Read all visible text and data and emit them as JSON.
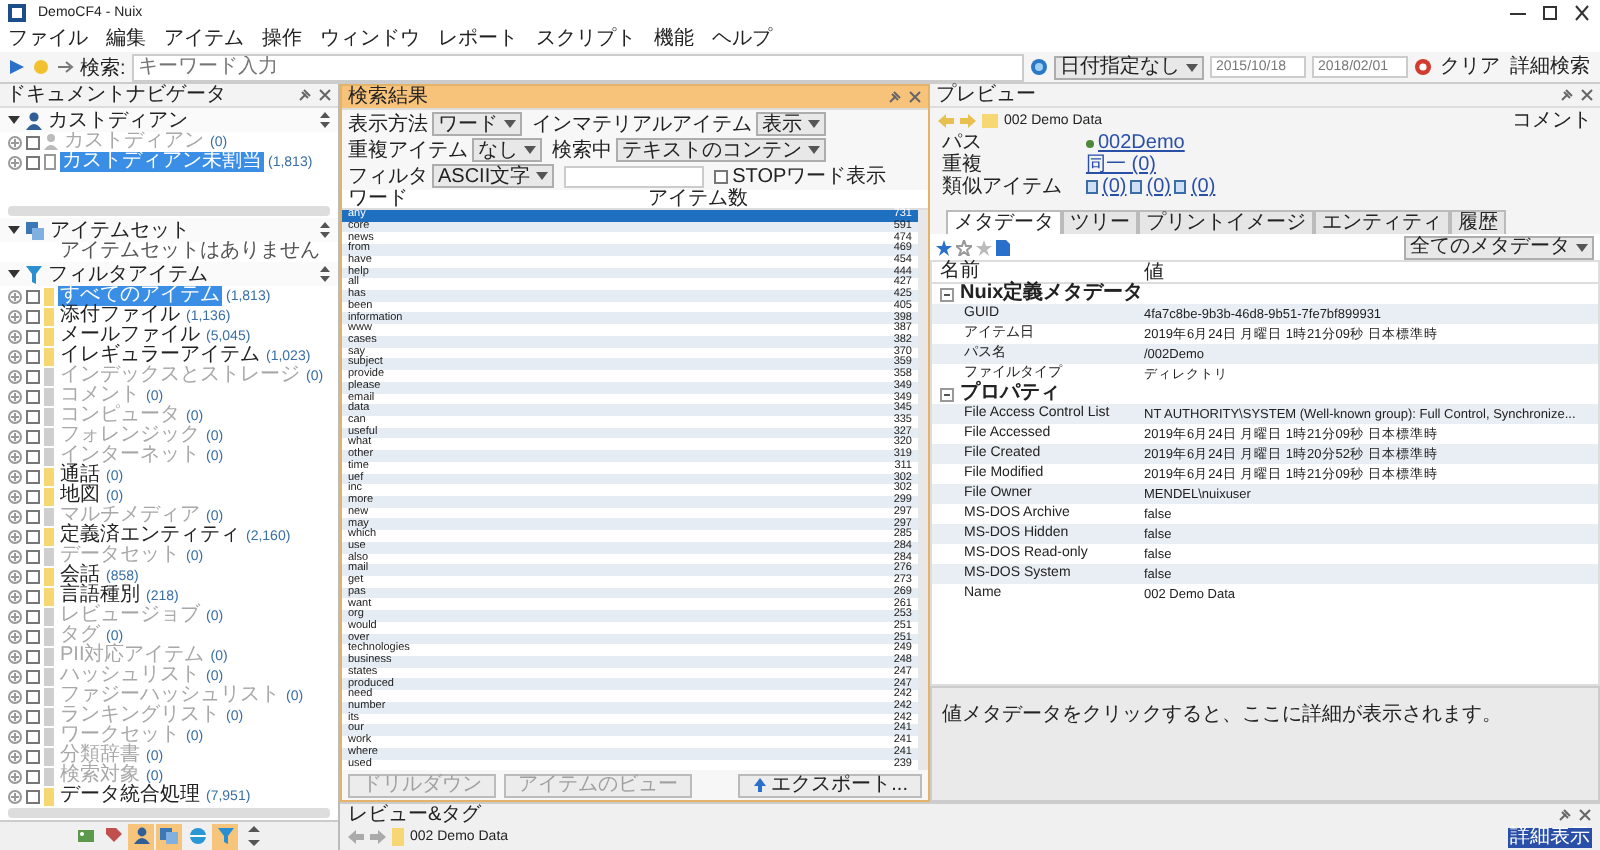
{
  "window": {
    "title": "DemoCF4 - Nuix"
  },
  "menu": [
    {
      "label": "ファイル"
    },
    {
      "label": "編集"
    },
    {
      "label": "アイテム"
    },
    {
      "label": "操作"
    },
    {
      "label": "ウィンドウ"
    },
    {
      "label": "レポート"
    },
    {
      "label": "スクリプト"
    },
    {
      "label": "機能"
    },
    {
      "label": "ヘルプ"
    }
  ],
  "toolbar": {
    "search_label": "検索:",
    "search_placeholder": "キーワード入力",
    "date_filter": "日付指定なし",
    "date_from": "2015/10/18",
    "date_to": "2018/02/01",
    "clear": "クリア",
    "advanced": "詳細検索"
  },
  "navigator": {
    "title": "ドキュメントナビゲータ",
    "custodian": {
      "title": "カストディアン",
      "items": [
        {
          "label": "カストディアン",
          "count": "(0)",
          "disabled": true,
          "selected": false,
          "checked": false
        },
        {
          "label": "カストディアン未割当",
          "count": "(1,813)",
          "disabled": false,
          "selected": true,
          "checked": false
        }
      ]
    },
    "item_sets": {
      "title": "アイテムセット",
      "hint": "アイテムセットはありません"
    },
    "filters": {
      "title": "フィルタアイテム",
      "items": [
        {
          "label": "すべてのアイテム",
          "count": "(1,813)",
          "disabled": false,
          "selected": true,
          "checked": false
        },
        {
          "label": "添付ファイル",
          "count": "(1,136)",
          "disabled": false,
          "selected": false,
          "checked": false
        },
        {
          "label": "メールファイル",
          "count": "(5,045)",
          "disabled": false,
          "selected": false,
          "checked": false
        },
        {
          "label": "イレギュラーアイテム",
          "count": "(1,023)",
          "disabled": false,
          "selected": false,
          "checked": false
        },
        {
          "label": "インデックスとストレージ",
          "count": "(0)",
          "disabled": true,
          "selected": false,
          "checked": false
        },
        {
          "label": "コメント",
          "count": "(0)",
          "disabled": true,
          "selected": false,
          "checked": false
        },
        {
          "label": "コンピュータ",
          "count": "(0)",
          "disabled": true,
          "selected": false,
          "checked": false
        },
        {
          "label": "フォレンジック",
          "count": "(0)",
          "disabled": true,
          "selected": false,
          "checked": false
        },
        {
          "label": "インターネット",
          "count": "(0)",
          "disabled": true,
          "selected": false,
          "checked": false
        },
        {
          "label": "通話",
          "count": "(0)",
          "disabled": false,
          "selected": false,
          "checked": false
        },
        {
          "label": "地図",
          "count": "(0)",
          "disabled": false,
          "selected": false,
          "checked": false
        },
        {
          "label": "マルチメディア",
          "count": "(0)",
          "disabled": true,
          "selected": false,
          "checked": false
        },
        {
          "label": "定義済エンティティ",
          "count": "(2,160)",
          "disabled": false,
          "selected": false,
          "checked": false
        },
        {
          "label": "データセット",
          "count": "(0)",
          "disabled": true,
          "selected": false,
          "checked": false
        },
        {
          "label": "会話",
          "count": "(858)",
          "disabled": false,
          "selected": false,
          "checked": false
        },
        {
          "label": "言語種別",
          "count": "(218)",
          "disabled": false,
          "selected": false,
          "checked": false
        },
        {
          "label": "レビュージョブ",
          "count": "(0)",
          "disabled": true,
          "selected": false,
          "checked": false
        },
        {
          "label": "タグ",
          "count": "(0)",
          "disabled": true,
          "selected": false,
          "checked": false
        },
        {
          "label": "PII対応アイテム",
          "count": "(0)",
          "disabled": true,
          "selected": false,
          "checked": false
        },
        {
          "label": "ハッシュリスト",
          "count": "(0)",
          "disabled": true,
          "selected": false,
          "checked": false
        },
        {
          "label": "ファジーハッシュリスト",
          "count": "(0)",
          "disabled": true,
          "selected": false,
          "checked": false
        },
        {
          "label": "ランキングリスト",
          "count": "(0)",
          "disabled": true,
          "selected": false,
          "checked": false
        },
        {
          "label": "ワークセット",
          "count": "(0)",
          "disabled": true,
          "selected": false,
          "checked": false
        },
        {
          "label": "分類辞書",
          "count": "(0)",
          "disabled": true,
          "selected": false,
          "checked": false
        },
        {
          "label": "検索対象",
          "count": "(0)",
          "disabled": true,
          "selected": false,
          "checked": false
        },
        {
          "label": "データ統合処理",
          "count": "(7,951)",
          "disabled": false,
          "selected": false,
          "checked": false
        }
      ]
    },
    "nav_icons": [
      {
        "kind": "image",
        "selected": false
      },
      {
        "kind": "tag",
        "selected": false
      },
      {
        "kind": "person",
        "selected": true
      },
      {
        "kind": "sets",
        "selected": true
      },
      {
        "kind": "globe",
        "selected": false
      },
      {
        "kind": "filter",
        "selected": true
      },
      {
        "kind": "sort",
        "selected": false
      }
    ]
  },
  "search_results": {
    "title": "検索結果",
    "controls": [
      {
        "kind": "select",
        "label": "表示方法",
        "value": "ワード"
      },
      {
        "kind": "select",
        "label": "インマテリアルアイテム",
        "value": "表示"
      },
      {
        "kind": "select",
        "label": "重複アイテム",
        "value": "なし"
      },
      {
        "kind": "select",
        "label": "検索中",
        "value": "テキストのコンテン"
      },
      {
        "kind": "select",
        "label": "フィルタ",
        "value": "ASCII文字"
      },
      {
        "kind": "text"
      },
      {
        "kind": "checkbox",
        "label": "STOPワード表示",
        "checked": false
      }
    ],
    "columns": [
      "ワード",
      "アイテム数"
    ],
    "rows": [
      {
        "word": "any",
        "count": "731",
        "selected": true
      },
      {
        "word": "core",
        "count": "591",
        "selected": false
      },
      {
        "word": "news",
        "count": "474",
        "selected": false
      },
      {
        "word": "from",
        "count": "469",
        "selected": false
      },
      {
        "word": "have",
        "count": "454",
        "selected": false
      },
      {
        "word": "help",
        "count": "444",
        "selected": false
      },
      {
        "word": "all",
        "count": "427",
        "selected": false
      },
      {
        "word": "has",
        "count": "425",
        "selected": false
      },
      {
        "word": "been",
        "count": "405",
        "selected": false
      },
      {
        "word": "information",
        "count": "398",
        "selected": false
      },
      {
        "word": "www",
        "count": "387",
        "selected": false
      },
      {
        "word": "cases",
        "count": "382",
        "selected": false
      },
      {
        "word": "say",
        "count": "370",
        "selected": false
      },
      {
        "word": "subject",
        "count": "359",
        "selected": false
      },
      {
        "word": "provide",
        "count": "358",
        "selected": false
      },
      {
        "word": "please",
        "count": "349",
        "selected": false
      },
      {
        "word": "email",
        "count": "349",
        "selected": false
      },
      {
        "word": "data",
        "count": "345",
        "selected": false
      },
      {
        "word": "can",
        "count": "335",
        "selected": false
      },
      {
        "word": "useful",
        "count": "327",
        "selected": false
      },
      {
        "word": "what",
        "count": "320",
        "selected": false
      },
      {
        "word": "other",
        "count": "319",
        "selected": false
      },
      {
        "word": "time",
        "count": "311",
        "selected": false
      },
      {
        "word": "uef",
        "count": "302",
        "selected": false
      },
      {
        "word": "inc",
        "count": "302",
        "selected": false
      },
      {
        "word": "more",
        "count": "299",
        "selected": false
      },
      {
        "word": "new",
        "count": "297",
        "selected": false
      },
      {
        "word": "may",
        "count": "297",
        "selected": false
      },
      {
        "word": "which",
        "count": "285",
        "selected": false
      },
      {
        "word": "use",
        "count": "284",
        "selected": false
      },
      {
        "word": "also",
        "count": "284",
        "selected": false
      },
      {
        "word": "mail",
        "count": "276",
        "selected": false
      },
      {
        "word": "get",
        "count": "273",
        "selected": false
      },
      {
        "word": "pas",
        "count": "269",
        "selected": false
      },
      {
        "word": "want",
        "count": "261",
        "selected": false
      },
      {
        "word": "org",
        "count": "253",
        "selected": false
      },
      {
        "word": "would",
        "count": "251",
        "selected": false
      },
      {
        "word": "over",
        "count": "251",
        "selected": false
      },
      {
        "word": "technologies",
        "count": "249",
        "selected": false
      },
      {
        "word": "business",
        "count": "248",
        "selected": false
      },
      {
        "word": "states",
        "count": "247",
        "selected": false
      },
      {
        "word": "produced",
        "count": "247",
        "selected": false
      },
      {
        "word": "need",
        "count": "242",
        "selected": false
      },
      {
        "word": "number",
        "count": "242",
        "selected": false
      },
      {
        "word": "its",
        "count": "242",
        "selected": false
      },
      {
        "word": "our",
        "count": "241",
        "selected": false
      },
      {
        "word": "work",
        "count": "241",
        "selected": false
      },
      {
        "word": "where",
        "count": "241",
        "selected": false
      },
      {
        "word": "used",
        "count": "239",
        "selected": false
      }
    ],
    "buttons": [
      {
        "label": "ドリルダウン",
        "disabled": true
      },
      {
        "label": "アイテムのビュー",
        "disabled": true
      }
    ],
    "export": "エクスポート..."
  },
  "preview": {
    "title": "プレビュー",
    "item": "002 Demo Data",
    "comment": "コメント",
    "path_label": "パス",
    "path": "002Demo",
    "dup_label": "重複",
    "dup": "同一 (0)",
    "similar_label": "類似アイテム",
    "similar": [
      {
        "count": "(0)"
      },
      {
        "count": "(0)"
      },
      {
        "count": "(0)"
      }
    ],
    "tabs": [
      {
        "label": "メタデータ",
        "selected": true
      },
      {
        "label": "ツリー",
        "selected": false
      },
      {
        "label": "プリントイメージ",
        "selected": false
      },
      {
        "label": "エンティティ",
        "selected": false
      },
      {
        "label": "履歴",
        "selected": false
      }
    ],
    "meta_filter": "全てのメタデータ",
    "columns": [
      "名前",
      "値"
    ],
    "groups": [
      {
        "name": "Nuix定義メタデータ",
        "expanded": true,
        "children": [
          {
            "name": "GUID",
            "value": "4fa7c8be-9b3b-46d8-9b51-7fe7bf899931"
          },
          {
            "name": "アイテム日",
            "value": "2019年6月24日 月曜日 1時21分09秒 日本標準時"
          },
          {
            "name": "パス名",
            "value": "/002Demo"
          },
          {
            "name": "ファイルタイプ",
            "value": "ディレクトリ"
          }
        ]
      },
      {
        "name": "プロパティ",
        "expanded": true,
        "children": [
          {
            "name": "File Access Control List",
            "value": "NT AUTHORITY\\SYSTEM (Well-known group): Full Control, Synchronize..."
          },
          {
            "name": "File Accessed",
            "value": "2019年6月24日 月曜日 1時21分09秒 日本標準時"
          },
          {
            "name": "File Created",
            "value": "2019年6月24日 月曜日 1時20分52秒 日本標準時"
          },
          {
            "name": "File Modified",
            "value": "2019年6月24日 月曜日 1時21分09秒 日本標準時"
          },
          {
            "name": "File Owner",
            "value": "MENDEL\\nuixuser"
          },
          {
            "name": "MS-DOS Archive",
            "value": "false"
          },
          {
            "name": "MS-DOS Hidden",
            "value": "false"
          },
          {
            "name": "MS-DOS Read-only",
            "value": "false"
          },
          {
            "name": "MS-DOS System",
            "value": "false"
          },
          {
            "name": "Name",
            "value": "002 Demo Data"
          }
        ]
      }
    ],
    "hint": "値メタデータをクリックすると、ここに詳細が表示されます。"
  },
  "review": {
    "title": "レビュー&タグ",
    "item": "002 Demo Data",
    "link": "詳細表示"
  }
}
